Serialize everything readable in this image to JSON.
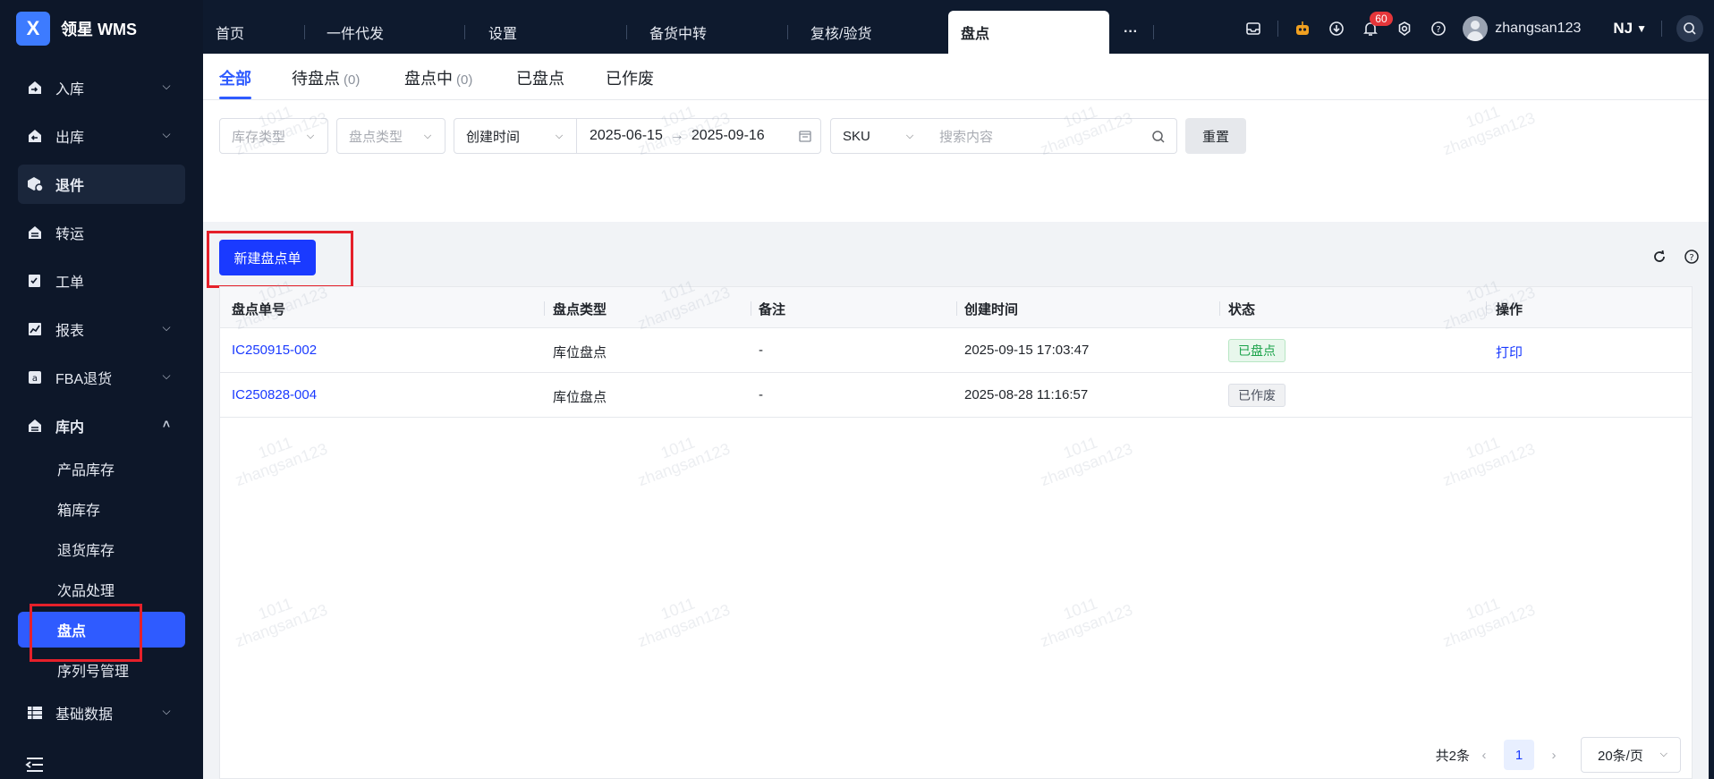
{
  "app": {
    "logo_letter": "X",
    "name": "领星 WMS"
  },
  "sidebar": {
    "items": [
      {
        "label": "入库",
        "icon": "inbound-icon",
        "chevron": "down"
      },
      {
        "label": "出库",
        "icon": "outbound-icon",
        "chevron": "down"
      },
      {
        "label": "退件",
        "icon": "returns-icon",
        "chevron": ""
      },
      {
        "label": "转运",
        "icon": "transfer-icon",
        "chevron": ""
      },
      {
        "label": "工单",
        "icon": "work-order-icon",
        "chevron": ""
      },
      {
        "label": "报表",
        "icon": "report-icon",
        "chevron": "down"
      },
      {
        "label": "FBA退货",
        "icon": "fba-icon",
        "chevron": "down"
      },
      {
        "label": "库内",
        "icon": "warehouse-icon",
        "chevron": "up"
      }
    ],
    "sub_items": [
      "产品库存",
      "箱库存",
      "退货库存",
      "次品处理",
      "盘点",
      "序列号管理"
    ],
    "bottom_item": {
      "label": "基础数据",
      "icon": "master-data-icon",
      "chevron": "down"
    }
  },
  "topbar": {
    "tabs": [
      "首页",
      "一件代发",
      "设置",
      "备货中转",
      "复核/验货",
      "盘点"
    ],
    "more": "···",
    "notification_count": "60",
    "username": "zhangsan123",
    "org": "NJ"
  },
  "subtabs": [
    {
      "label": "全部",
      "count": ""
    },
    {
      "label": "待盘点",
      "count": "(0)"
    },
    {
      "label": "盘点中",
      "count": "(0)"
    },
    {
      "label": "已盘点",
      "count": ""
    },
    {
      "label": "已作废",
      "count": ""
    }
  ],
  "filters": {
    "stock_type_placeholder": "库存类型",
    "count_type_placeholder": "盘点类型",
    "time_field": "创建时间",
    "date_start": "2025-06-15",
    "date_end": "2025-09-16",
    "search_field": "SKU",
    "search_placeholder": "搜索内容",
    "reset_label": "重置"
  },
  "actions": {
    "create_label": "新建盘点单"
  },
  "table": {
    "columns": [
      "盘点单号",
      "盘点类型",
      "备注",
      "创建时间",
      "状态",
      "操作"
    ],
    "rows": [
      {
        "id": "IC250915-002",
        "type": "库位盘点",
        "note": "-",
        "created": "2025-09-15 17:03:47",
        "status": "已盘点",
        "status_color": "green",
        "action": "打印"
      },
      {
        "id": "IC250828-004",
        "type": "库位盘点",
        "note": "-",
        "created": "2025-08-28 11:16:57",
        "status": "已作废",
        "status_color": "gray",
        "action": ""
      }
    ]
  },
  "pagination": {
    "total": "共2条",
    "current": "1",
    "page_size": "20条/页"
  },
  "watermark": {
    "line1": "1011",
    "line2": "zhangsan123"
  },
  "colors": {
    "primary": "#1a3aff",
    "sidebar_bg": "#0d1729",
    "active_menu": "#2f5bff",
    "highlight": "#e5202a"
  }
}
